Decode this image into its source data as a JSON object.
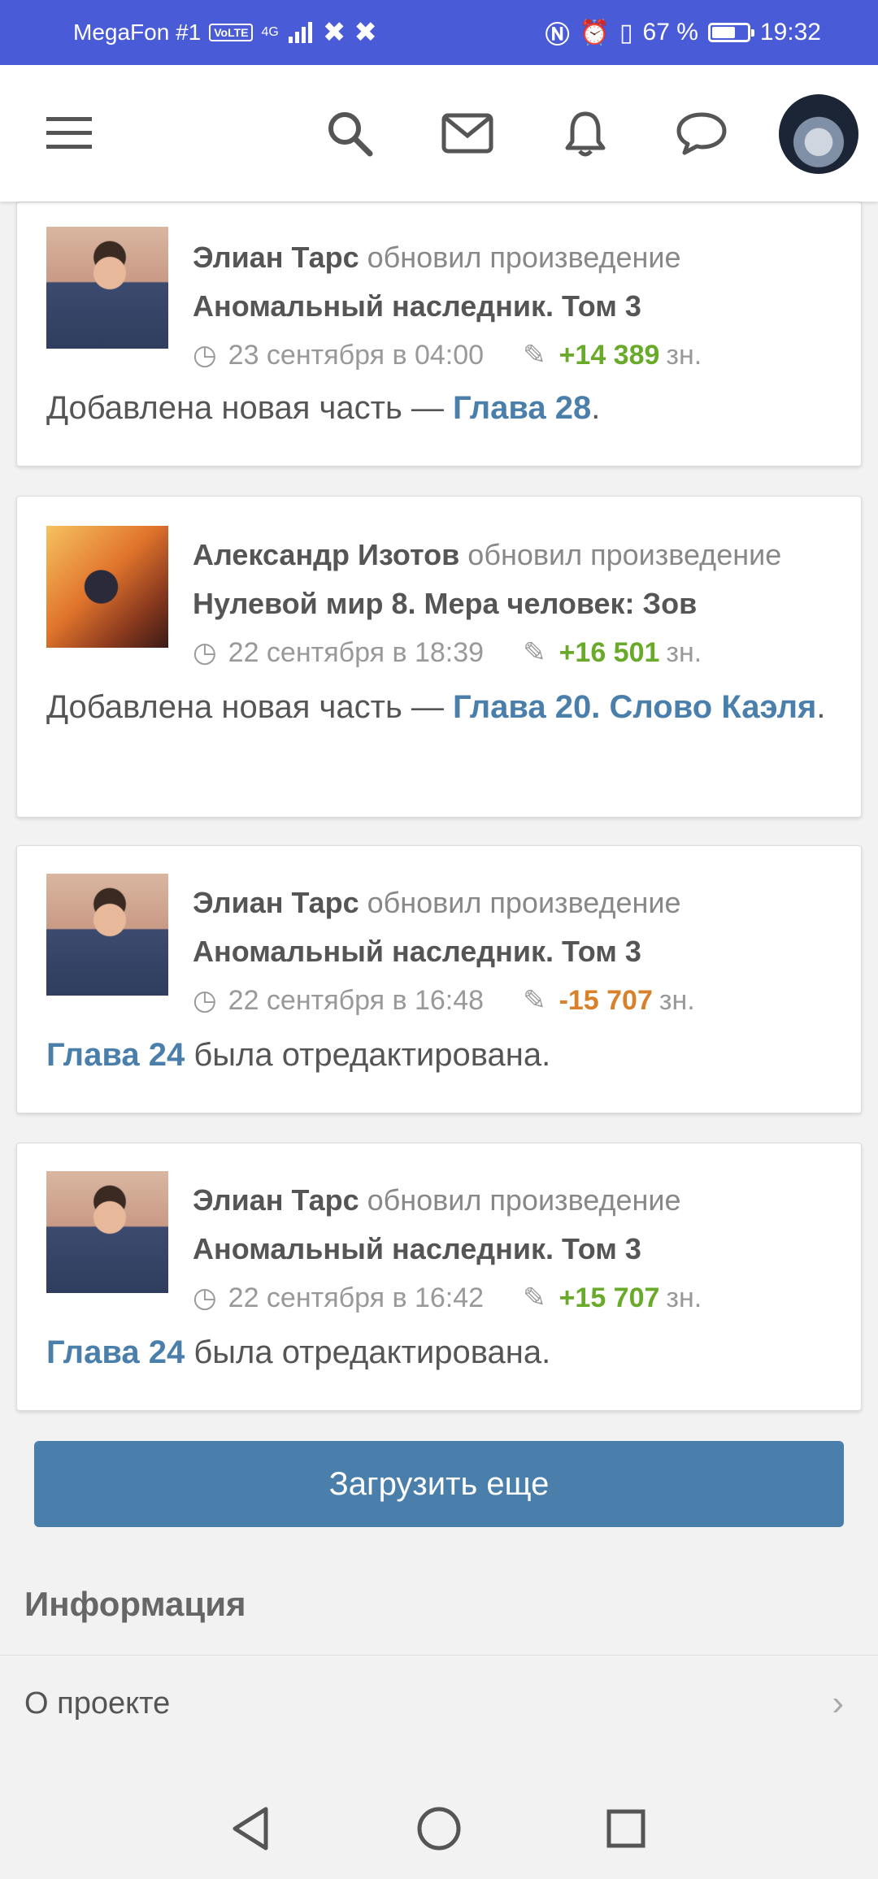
{
  "status_bar": {
    "carrier": "MegaFon #1",
    "volte": "VoLTE",
    "network": "4G",
    "battery": "67 %",
    "battery_level": 0.67,
    "time": "19:32"
  },
  "app_bar": {
    "icons": [
      "menu-icon",
      "search-icon",
      "mail-icon",
      "bell-icon",
      "chat-icon",
      "user-avatar"
    ]
  },
  "feed": [
    {
      "author": "Элиан Тарс",
      "action": "обновил произведение",
      "work": "Аномальный наследник. Том 3",
      "date": "23 сентября в 04:00",
      "delta": "+14 389",
      "delta_type": "positive",
      "unit": "зн.",
      "message_prefix": "Добавлена новая часть — ",
      "message_link": "Глава 28",
      "message_suffix": "."
    },
    {
      "author": "Александр Изотов",
      "action": "обновил произведение",
      "work": "Нулевой мир 8. Мера человек: Зов",
      "date": "22 сентября в 18:39",
      "delta": "+16 501",
      "delta_type": "positive",
      "unit": "зн.",
      "message_prefix": "Добавлена новая часть — ",
      "message_link": "Глава 20. Слово Каэля",
      "message_suffix": "."
    },
    {
      "author": "Элиан Тарс",
      "action": "обновил произведение",
      "work": "Аномальный наследник. Том 3",
      "date": "22 сентября в 16:48",
      "delta": "-15 707",
      "delta_type": "negative",
      "unit": "зн.",
      "message_prefix": "",
      "message_link": "Глава 24",
      "message_suffix": " была отредактирована."
    },
    {
      "author": "Элиан Тарс",
      "action": "обновил произведение",
      "work": "Аномальный наследник. Том 3",
      "date": "22 сентября в 16:42",
      "delta": "+15 707",
      "delta_type": "positive",
      "unit": "зн.",
      "message_prefix": "",
      "message_link": "Глава 24",
      "message_suffix": " была отредактирована."
    }
  ],
  "load_more": "Загрузить еще",
  "info": {
    "title": "Информация",
    "items": [
      {
        "label": "О проекте"
      }
    ]
  },
  "colors": {
    "status_bar": "#4a5bd8",
    "link": "#4a7fab",
    "positive": "#6aaa2a",
    "negative": "#d8802a",
    "button": "#4a7fab"
  }
}
